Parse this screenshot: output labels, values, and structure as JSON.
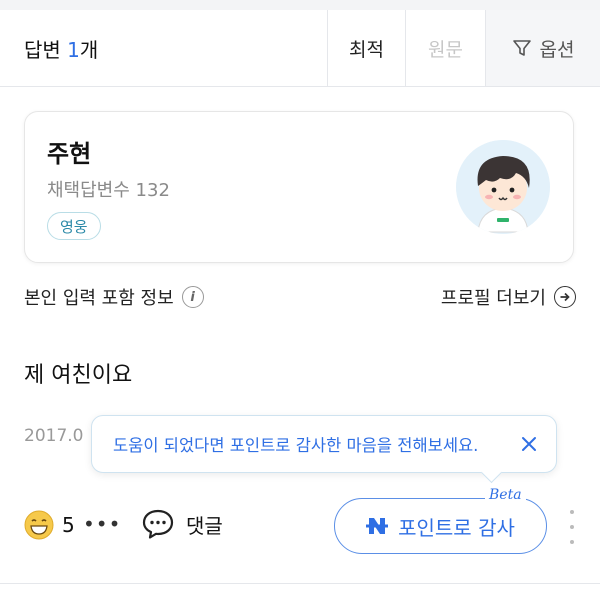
{
  "header": {
    "answers_label": "답변",
    "answers_count": "1",
    "answers_unit": "개",
    "sort_best": "최적",
    "sort_original": "원문",
    "options": "옵션"
  },
  "profile": {
    "name": "주현",
    "adopted_label": "채택답변수",
    "adopted_count": "132",
    "badge": "영웅",
    "info_label": "본인 입력 포함 정보",
    "more_profile": "프로필 더보기"
  },
  "answer": {
    "text": "제 여친이요",
    "date": "2017.0"
  },
  "tooltip": {
    "text": "도움이 되었다면 포인트로 감사한 마음을 전해보세요."
  },
  "actions": {
    "reaction_count": "5",
    "more": "•••",
    "comment_label": "댓글",
    "point_label": "포인트로 감사",
    "beta": "Beta"
  },
  "colors": {
    "accent": "#2f6fe4",
    "badge_border": "#b9dde6",
    "muted": "#8a8a8a"
  },
  "icons": {
    "options": "filter-icon",
    "info": "info-icon",
    "more_profile": "arrow-right-circle-icon",
    "close": "close-icon",
    "reaction": "grinning-face-icon",
    "comment": "speech-bubble-icon",
    "point": "naver-n-icon",
    "kebab": "vertical-dots-icon"
  }
}
